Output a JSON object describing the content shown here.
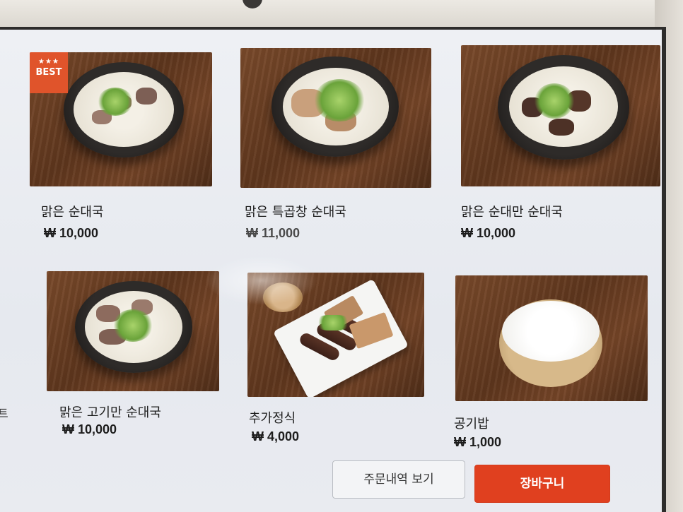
{
  "menu": {
    "items": [
      {
        "name": "맑은 순대국",
        "price": "₩ 10,000",
        "badge": {
          "stars": "★★★",
          "label": "BEST"
        }
      },
      {
        "name": "맑은 특곱창 순대국",
        "price": "₩ 11,000"
      },
      {
        "name": "맑은 순대만 순대국",
        "price": "₩ 10,000"
      },
      {
        "name": "맑은 고기만 순대국",
        "price": "₩ 10,000"
      },
      {
        "name": "추가정식",
        "price": "₩ 4,000"
      },
      {
        "name": "공기밥",
        "price": "₩ 1,000"
      }
    ]
  },
  "side_partial_label": "트",
  "footer": {
    "order_history_label": "주문내역 보기",
    "cart_label": "장바구니"
  },
  "colors": {
    "accent": "#e0401f",
    "badge": "#e0542b"
  },
  "icons": {
    "front_camera": "camera-icon"
  }
}
